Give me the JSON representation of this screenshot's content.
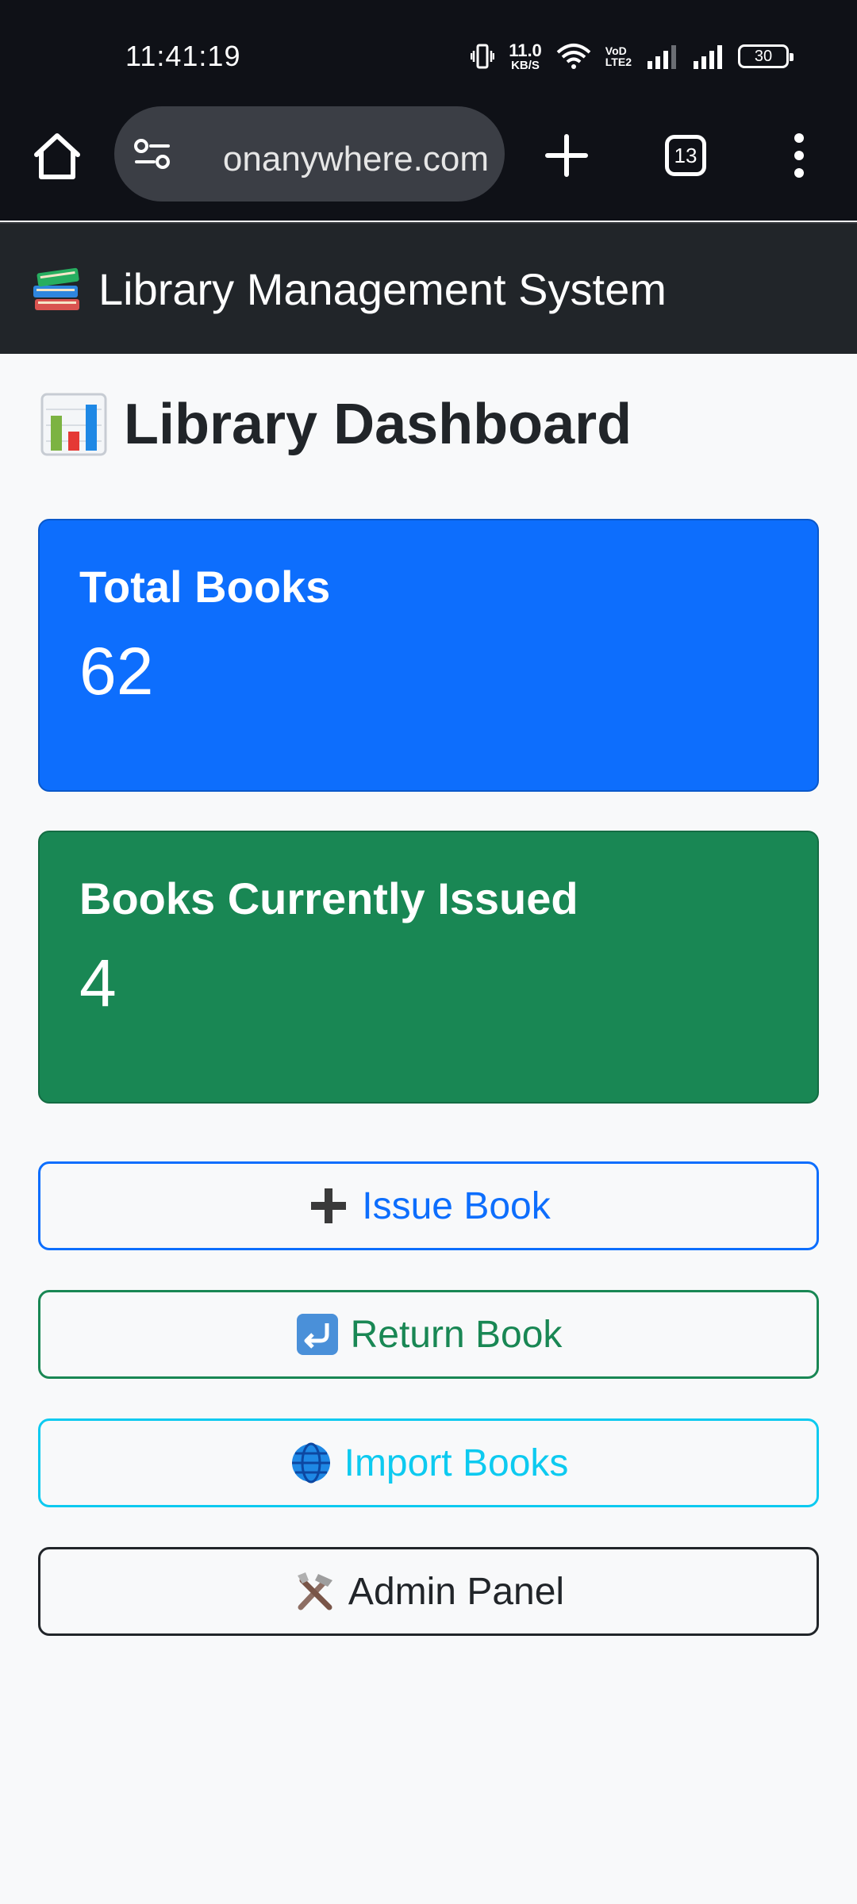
{
  "status_bar": {
    "time": "11:41:19",
    "net_speed_value": "11.0",
    "net_speed_unit": "KB/S",
    "volte_top": "VoD",
    "volte_bottom": "LTE2",
    "battery": "30",
    "icons": [
      "vibrate-icon",
      "wifi-icon",
      "signal-icon",
      "signal-icon",
      "battery-icon"
    ]
  },
  "browser": {
    "url": "onanywhere.com",
    "tab_count": "13",
    "icons": [
      "home-icon",
      "site-settings-icon",
      "plus-icon",
      "tabs-icon",
      "more-vert-icon"
    ]
  },
  "navbar": {
    "brand_text": "Library Management System",
    "brand_icon": "books-icon"
  },
  "dashboard": {
    "title": "Library Dashboard",
    "title_icon": "bar-chart-icon",
    "cards": [
      {
        "label": "Total Books",
        "value": "62",
        "color": "#0d6efd"
      },
      {
        "label": "Books Currently Issued",
        "value": "4",
        "color": "#198754"
      }
    ],
    "buttons": [
      {
        "label": "Issue Book",
        "icon": "plus-icon",
        "color": "#0d6efd"
      },
      {
        "label": "Return Book",
        "icon": "return-arrow-icon",
        "color": "#198754"
      },
      {
        "label": "Import Books",
        "icon": "globe-icon",
        "color": "#0dcaf0"
      },
      {
        "label": "Admin Panel",
        "icon": "tools-icon",
        "color": "#212529"
      }
    ]
  }
}
